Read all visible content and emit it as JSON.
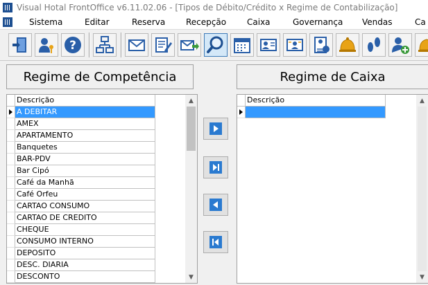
{
  "window": {
    "title": "Visual Hotal FrontOffice v6.11.02.06 - [Tipos de Débito/Crédito x Regime de Contabilização]"
  },
  "menu": {
    "items": [
      "Sistema",
      "Editar",
      "Reserva",
      "Recepção",
      "Caixa",
      "Governança",
      "Vendas",
      "Ca"
    ]
  },
  "toolbar": {
    "buttons": [
      "exit-icon",
      "user-key-icon",
      "help-icon",
      "org-chart-icon",
      "mail-icon",
      "notes-pen-icon",
      "mail-send-icon",
      "search-icon",
      "calendar-icon",
      "guest-card-icon",
      "guest-list-icon",
      "guest-form-icon",
      "bell-icon",
      "footprints-icon",
      "add-user-icon",
      "bell-add-icon"
    ]
  },
  "left_panel": {
    "title": "Regime de Competência",
    "column": "Descrição",
    "rows": [
      "A DEBITAR",
      "AMEX",
      "APARTAMENTO",
      "Banquetes",
      "BAR-PDV",
      "Bar Cipó",
      "Café da Manhã",
      "Café Orfeu",
      "CARTAO CONSUMO",
      "CARTAO DE CREDITO",
      "CHEQUE",
      "CONSUMO INTERNO",
      "DEPOSITO",
      "DESC. DIARIA",
      "DESCONTO"
    ],
    "selected_index": 0,
    "scroll_position": 0
  },
  "right_panel": {
    "title": "Regime de Caixa",
    "column": "Descrição",
    "rows": [
      ""
    ],
    "selected_index": 0
  },
  "move_buttons": [
    "move-right-icon",
    "move-all-right-icon",
    "move-left-icon",
    "move-all-left-icon"
  ],
  "colors": {
    "selection": "#3399ff",
    "active_tool": "#d4e8f8"
  }
}
